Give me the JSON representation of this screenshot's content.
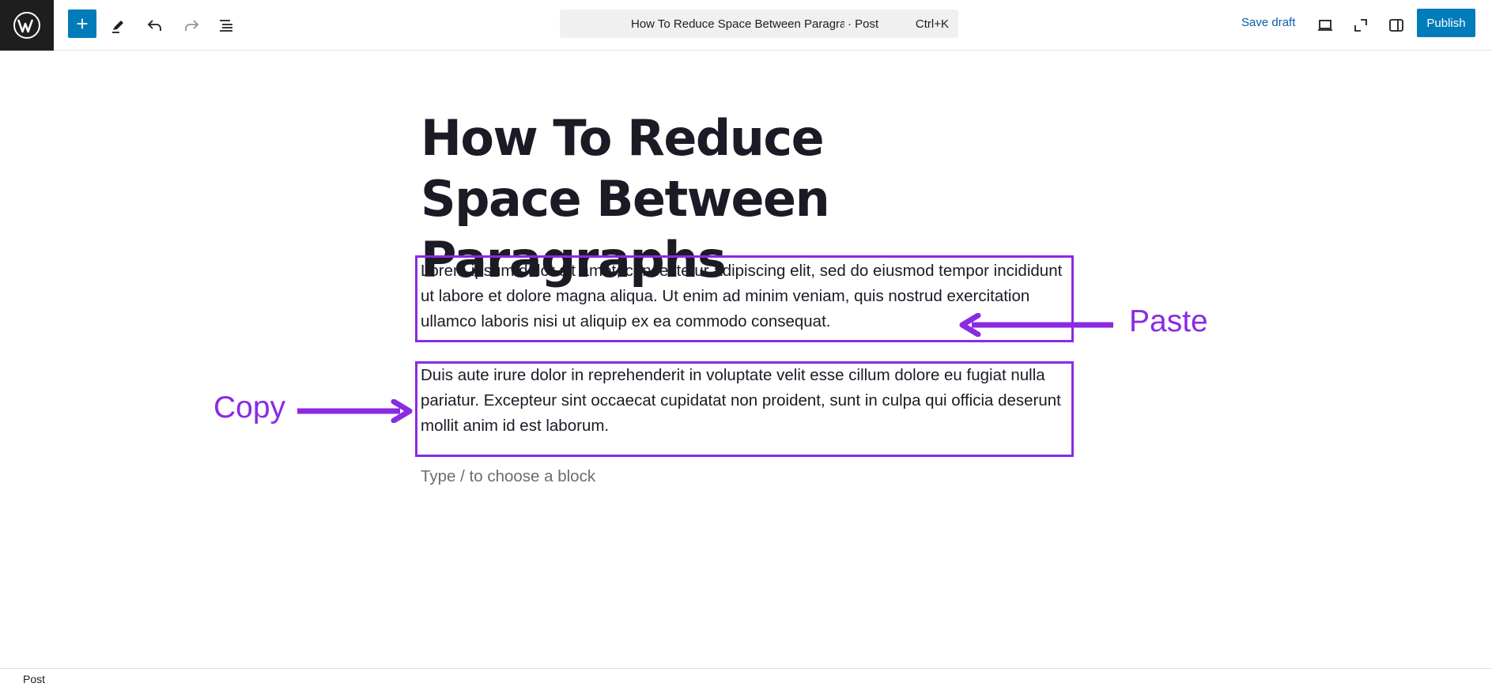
{
  "toolbar": {
    "document_title": "How To Reduce Space Between Paragra...",
    "document_type": "· Post",
    "command_shortcut": "Ctrl+K",
    "save_draft_label": "Save draft",
    "publish_label": "Publish"
  },
  "post": {
    "title": "How To Reduce Space Between Paragraphs",
    "paragraphs": [
      "Lorem ipsum dolor sit amet, consectetur adipiscing elit, sed do eiusmod tempor incididunt ut labore et dolore magna aliqua. Ut enim ad minim veniam, quis nostrud exercitation ullamco laboris nisi ut aliquip ex ea commodo consequat.",
      "Duis aute irure dolor in reprehenderit in voluptate velit esse cillum dolore eu fugiat nulla pariatur. Excepteur sint occaecat cupidatat non proident, sunt in culpa qui officia deserunt mollit anim id est laborum."
    ],
    "block_placeholder": "Type / to choose a block"
  },
  "annotations": {
    "paste_label": "Paste",
    "copy_label": "Copy",
    "color": "#8a2be2"
  },
  "footer": {
    "breadcrumb": "Post"
  },
  "colors": {
    "accent": "#007cba",
    "link": "#0a5ea8",
    "logo_bg": "#1e1e1e"
  },
  "icons": {
    "logo": "wordpress-logo-icon",
    "add": "plus-icon",
    "tools": "pencil-icon",
    "undo": "undo-icon",
    "redo": "redo-icon",
    "outline": "list-view-icon",
    "preview": "desktop-preview-icon",
    "fullscreen": "external-view-icon",
    "settings": "sidebar-settings-icon"
  }
}
